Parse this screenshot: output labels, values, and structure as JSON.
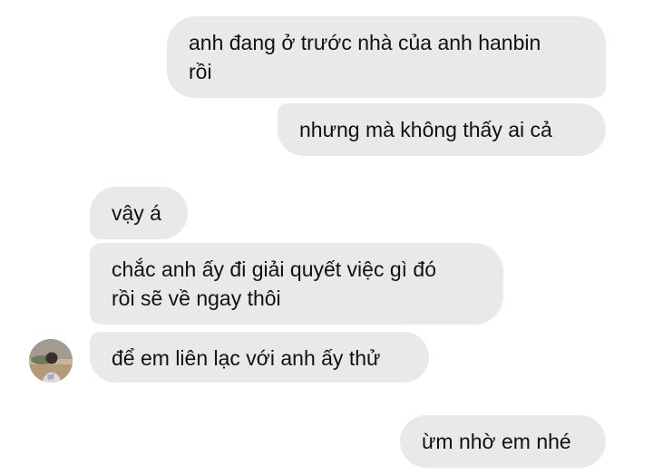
{
  "conversation": {
    "messages": [
      {
        "sender": "me",
        "lines": [
          "anh đang ở trước nhà của anh hanbin",
          "rồi"
        ]
      },
      {
        "sender": "me",
        "lines": [
          "nhưng mà không thấy ai cả"
        ]
      },
      {
        "sender": "them",
        "lines": [
          "vậy á"
        ]
      },
      {
        "sender": "them",
        "lines": [
          "chắc anh ấy đi giải quyết việc gì đó",
          "rồi sẽ về ngay thôi"
        ]
      },
      {
        "sender": "them",
        "lines": [
          "để em liên lạc với anh ấy thử"
        ]
      },
      {
        "sender": "me",
        "lines": [
          "ừm nhờ em nhé"
        ]
      }
    ],
    "avatar_icon": "contact-avatar",
    "colors": {
      "bubble": "#e9e9ec",
      "text": "#111111",
      "background": "#ffffff"
    }
  }
}
